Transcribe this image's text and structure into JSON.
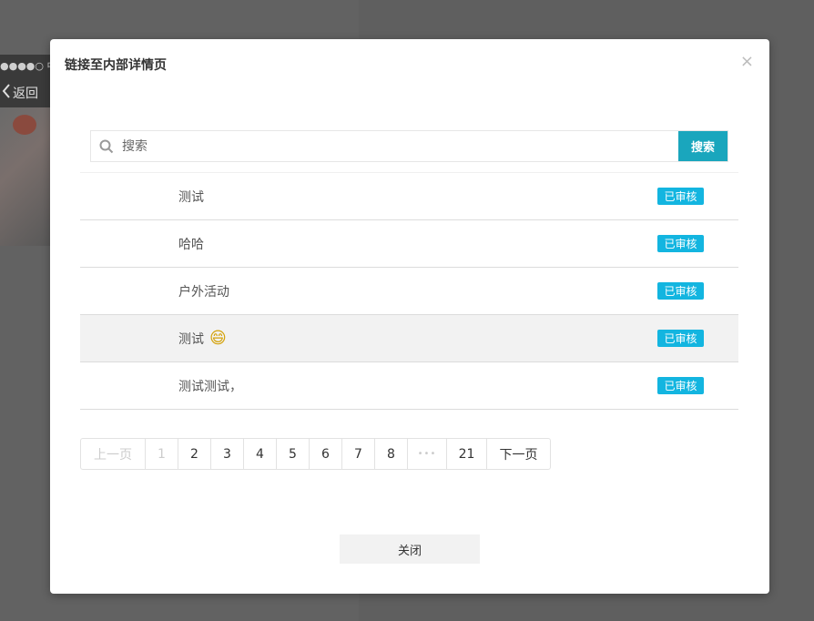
{
  "background": {
    "status_text": "●●●●○ 中国",
    "back_label": "返回"
  },
  "modal": {
    "title": "链接至内部详情页",
    "close_symbol": "×"
  },
  "search": {
    "placeholder": "搜索",
    "value": "",
    "button_label": "搜索"
  },
  "list": {
    "items": [
      {
        "title": "测试",
        "emoji": "",
        "status": "已审核"
      },
      {
        "title": "哈哈",
        "emoji": "",
        "status": "已审核"
      },
      {
        "title": "户外活动",
        "emoji": "",
        "status": "已审核"
      },
      {
        "title": "测试",
        "emoji": "😄",
        "status": "已审核"
      },
      {
        "title": "测试测试，",
        "emoji": "",
        "status": "已审核"
      }
    ]
  },
  "pagination": {
    "prev": "上一页",
    "pages": [
      "1",
      "2",
      "3",
      "4",
      "5",
      "6",
      "7",
      "8"
    ],
    "ellipsis": "•••",
    "last": "21",
    "next": "下一页",
    "current": "1"
  },
  "footer": {
    "close_label": "关闭"
  },
  "colors": {
    "accent": "#1aa6bd",
    "badge": "#13b5e0"
  },
  "icons": {
    "search": "search-icon",
    "close": "close-icon",
    "back": "chevron-left-icon"
  }
}
